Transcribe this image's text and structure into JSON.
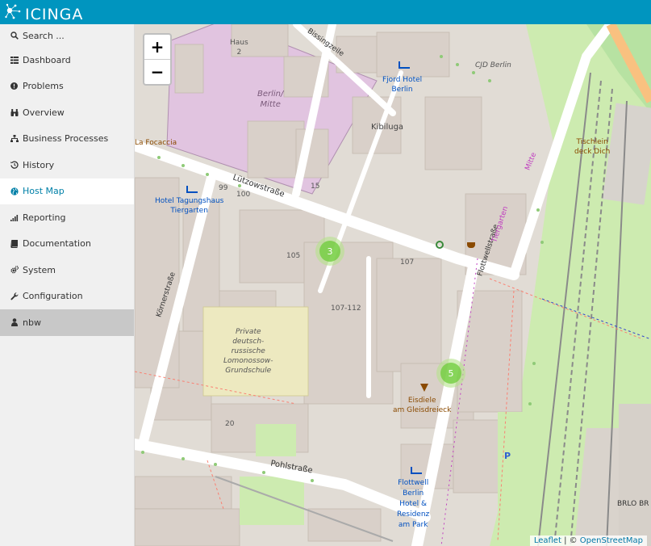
{
  "app": {
    "logo_text": "icinga"
  },
  "search": {
    "placeholder": "Search ..."
  },
  "nav": {
    "dashboard": "Dashboard",
    "problems": "Problems",
    "overview": "Overview",
    "business_processes": "Business Processes",
    "history": "History",
    "host_map": "Host Map",
    "reporting": "Reporting",
    "documentation": "Documentation",
    "system": "System",
    "configuration": "Configuration",
    "user": "nbw"
  },
  "map": {
    "zoom_in": "+",
    "zoom_out": "−",
    "clusters": [
      {
        "label": "3"
      },
      {
        "label": "5"
      }
    ],
    "attribution": {
      "leaflet": "Leaflet",
      "separator": " | © ",
      "osm": "OpenStreetMap"
    },
    "labels": {
      "fjord_hotel": "Fjord Hotel",
      "berlin_1": "Berlin",
      "kibiluga": "Kibiluga",
      "cjd": "CJD Berlin",
      "berlin_mitte_1": "Berlin/",
      "berlin_mitte_2": "Mitte",
      "la_focaccia": "La Focaccia",
      "hotel_tagung_1": "Hotel Tagungshaus",
      "hotel_tagung_2": "Tiergarten",
      "luetzow": "Lützowstraße",
      "bissing": "Bissingzeile",
      "koerner": "Körnerstraße",
      "flottwell": "Flottwellstraße",
      "pohl": "Pohlstraße",
      "tischlein_1": "Tischlein",
      "tischlein_2": "deck Dich",
      "private_1": "Private",
      "private_2": "deutsch-",
      "private_3": "russische",
      "private_4": "Lomonossow-",
      "private_5": "Grundschule",
      "eisdiele_1": "Eisdiele",
      "eisdiele_2": "am Gleisdreieck",
      "flottwell_hotel_1": "Flottwell",
      "flottwell_hotel_2": "Berlin",
      "flottwell_hotel_3": "Hotel &",
      "flottwell_hotel_4": "Residenz",
      "flottwell_hotel_5": "am Park",
      "brlo": "BRLO BR",
      "haus2_1": "Haus",
      "haus2_2": "2",
      "mitte_vert": "Mitte",
      "tiergarten_vert": "Tiergarten",
      "n107_112": "107-112",
      "n105": "105",
      "n107": "107",
      "n20": "20",
      "n15": "15",
      "n100": "100",
      "n99": "99"
    }
  }
}
